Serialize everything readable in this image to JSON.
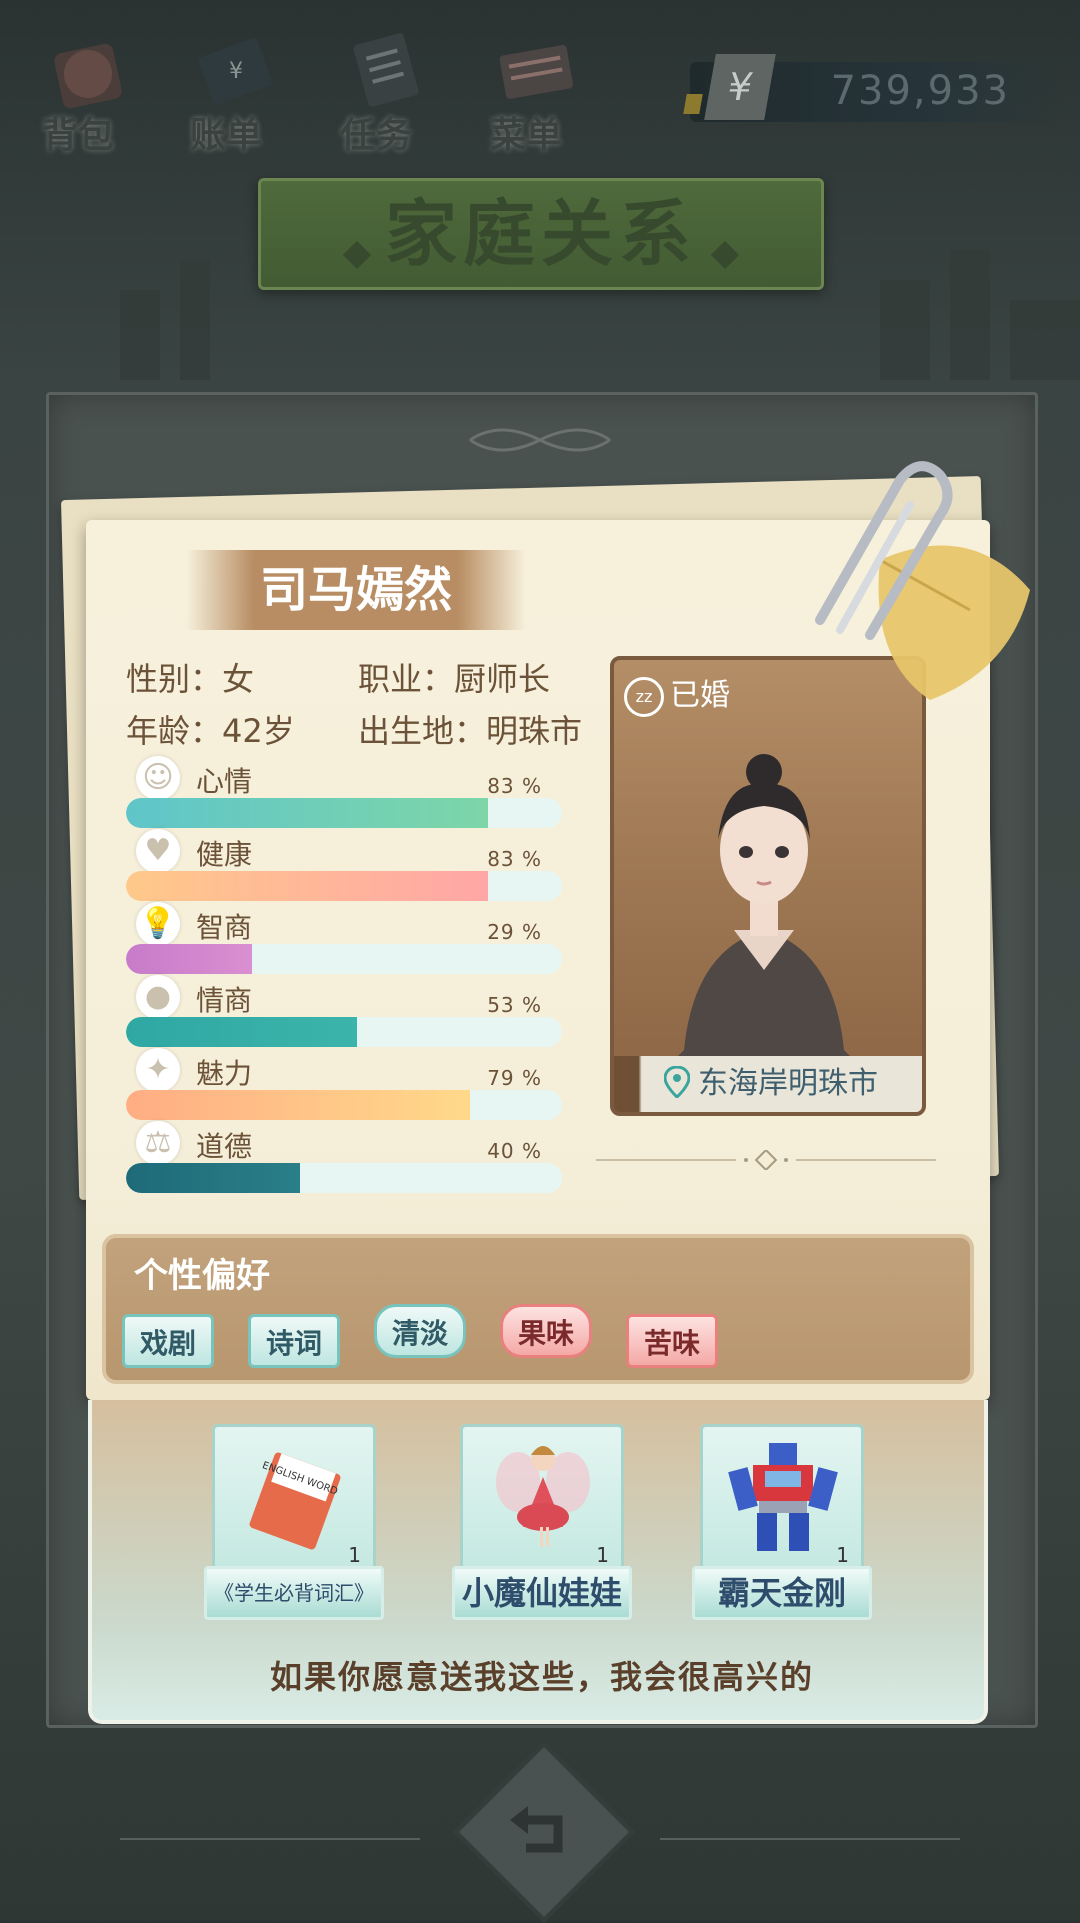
{
  "topbar": {
    "items": [
      {
        "label": "背包",
        "icon": "backpack-icon"
      },
      {
        "label": "账单",
        "icon": "wallet-icon"
      },
      {
        "label": "任务",
        "icon": "task-list-icon"
      },
      {
        "label": "菜单",
        "icon": "menu-book-icon"
      }
    ],
    "currency_symbol": "¥",
    "money": "739,933"
  },
  "page_title": "家庭关系",
  "character": {
    "name": "司马嫣然",
    "gender": "性别：女",
    "job": "职业：厨师长",
    "age": "年龄：42岁",
    "birthplace": "出生地：明珠市",
    "status": "已婚",
    "location": "东海岸明珠市"
  },
  "stats": [
    {
      "label": "心情",
      "percent": 83,
      "text": "83 %",
      "icon": "smile-icon",
      "colors": [
        "#5fc5c9",
        "#7dd6a8"
      ]
    },
    {
      "label": "健康",
      "percent": 83,
      "text": "83 %",
      "icon": "heart-icon",
      "colors": [
        "#ffc98a",
        "#ffa6a6"
      ]
    },
    {
      "label": "智商",
      "percent": 29,
      "text": "29 %",
      "icon": "lightbulb-icon",
      "colors": [
        "#c77bc9",
        "#d98fd0"
      ]
    },
    {
      "label": "情商",
      "percent": 53,
      "text": "53 %",
      "icon": "apple-icon",
      "colors": [
        "#2fa7a3",
        "#3bb5ab"
      ]
    },
    {
      "label": "魅力",
      "percent": 79,
      "text": "79 %",
      "icon": "sparkle-icon",
      "colors": [
        "#ffad84",
        "#ffd98a"
      ]
    },
    {
      "label": "道德",
      "percent": 40,
      "text": "40 %",
      "icon": "scales-icon",
      "colors": [
        "#1e6a79",
        "#2a7f88"
      ]
    }
  ],
  "preferences": {
    "title": "个性偏好",
    "tags": [
      {
        "label": "戏剧",
        "style": "teal"
      },
      {
        "label": "诗词",
        "style": "teal"
      },
      {
        "label": "清淡",
        "style": "teal-round"
      },
      {
        "label": "果味",
        "style": "pink-round"
      },
      {
        "label": "苦味",
        "style": "pink"
      }
    ]
  },
  "gifts": [
    {
      "name": "《学生必背词汇》",
      "count": "1",
      "icon": "english-book-icon",
      "book_text": "ENGLISH WORD"
    },
    {
      "name": "小魔仙娃娃",
      "count": "1",
      "icon": "fairy-doll-icon"
    },
    {
      "name": "霸天金刚",
      "count": "1",
      "icon": "robot-toy-icon"
    }
  ],
  "gift_message": "如果你愿意送我这些，我会很高兴的"
}
